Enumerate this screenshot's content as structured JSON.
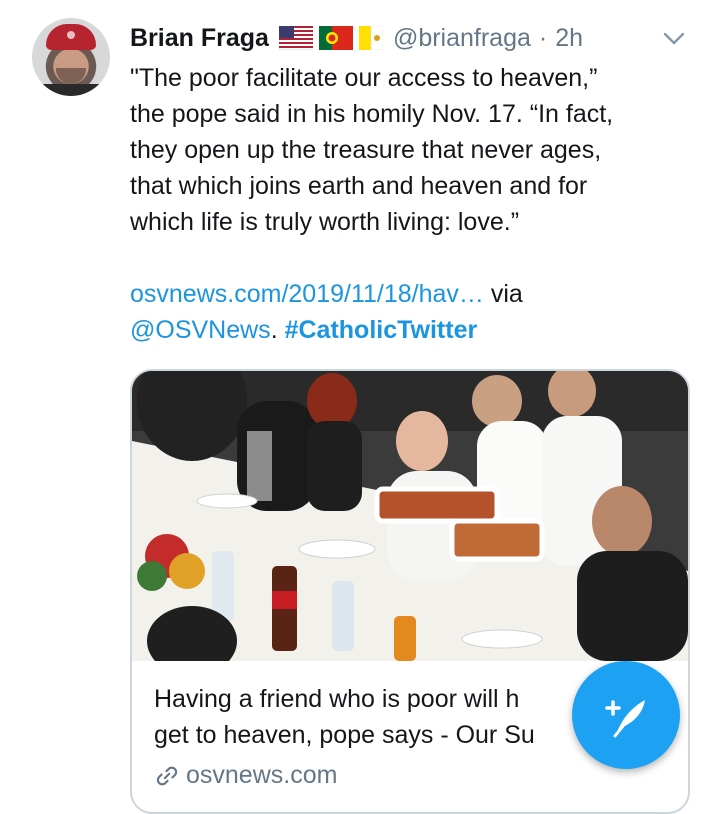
{
  "tweet": {
    "author_name": "Brian Fraga",
    "handle": "@brianfraga",
    "separator": "·",
    "time": "2h",
    "flags": [
      "us-flag-icon",
      "portugal-flag-icon",
      "vatican-flag-icon"
    ],
    "text_lines": [
      "\"The poor facilitate our access to heaven,”",
      "the pope said in his homily Nov. 17. “In fact,",
      "they open up the treasure that never ages,",
      "that which joins earth and heaven and for",
      "which life is truly worth living: love.”"
    ],
    "link_text": "osvnews.com/2019/11/18/hav…",
    "via_text": " via",
    "mention": "@OSVNews",
    "period": ". ",
    "hashtag": "#CatholicTwitter"
  },
  "card": {
    "title_line1": "Having a friend who is poor will h",
    "title_line2": "get to heaven, pope says - Our Su",
    "domain": "osvnews.com",
    "image_icon": "photo-image"
  },
  "colors": {
    "link": "#1b95e0",
    "secondary_text": "#657786",
    "fab": "#1da1f2",
    "border": "#ccd6dd"
  },
  "fab": {
    "icon": "compose-tweet-icon"
  }
}
